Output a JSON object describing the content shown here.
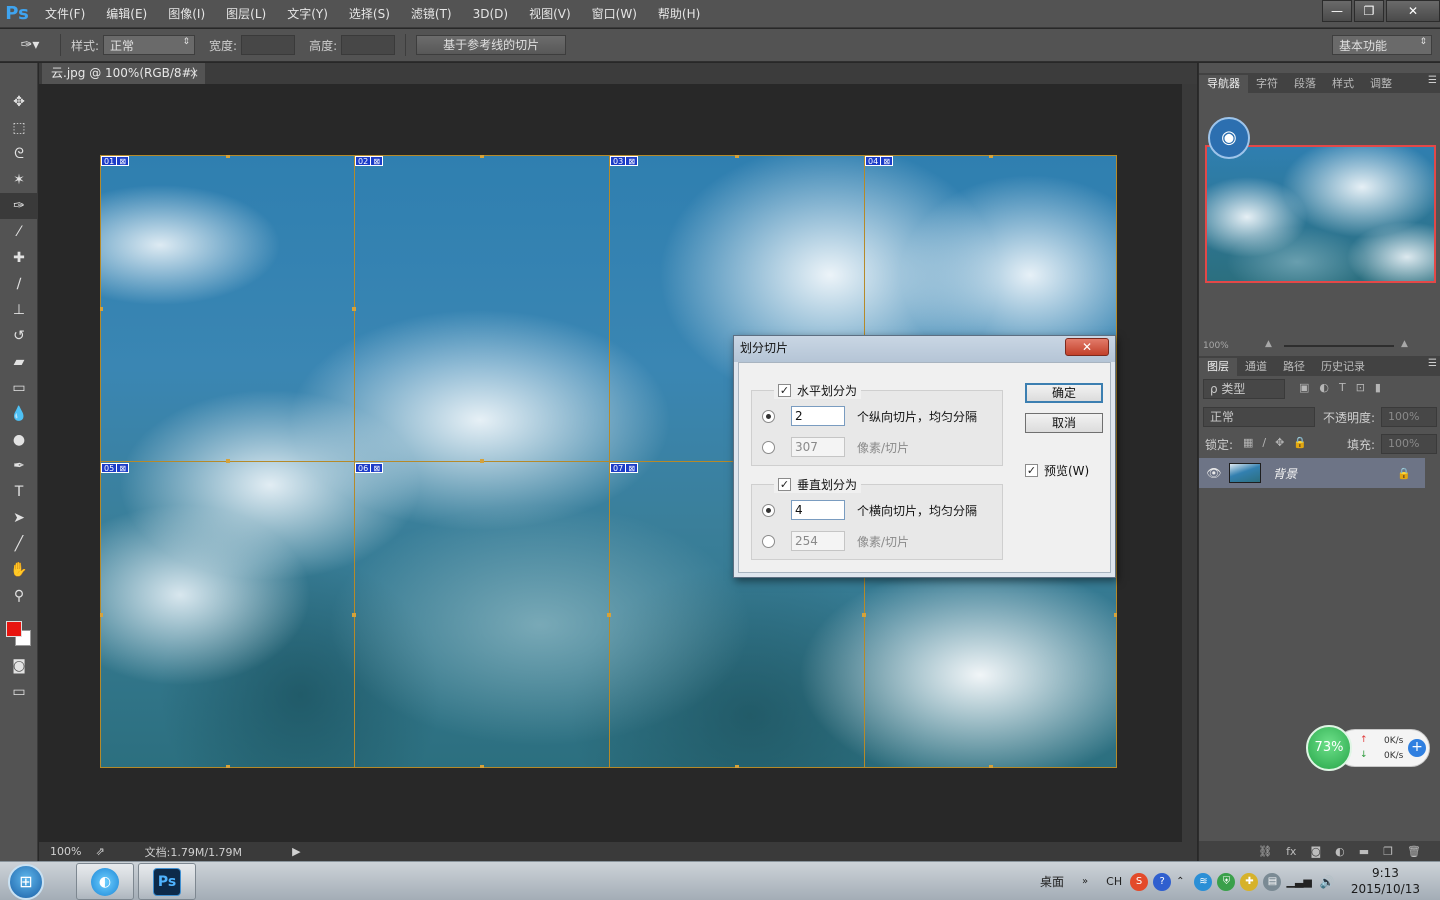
{
  "app": {
    "logo": "Ps"
  },
  "menu": [
    "文件(F)",
    "编辑(E)",
    "图像(I)",
    "图层(L)",
    "文字(Y)",
    "选择(S)",
    "滤镜(T)",
    "3D(D)",
    "视图(V)",
    "窗口(W)",
    "帮助(H)"
  ],
  "window_controls": {
    "minimize": "—",
    "restore": "❐",
    "close": "✕"
  },
  "options": {
    "style_label": "样式:",
    "style_value": "正常",
    "width_label": "宽度:",
    "height_label": "高度:",
    "slice_from_guides": "基于参考线的切片",
    "workspace": "基本功能"
  },
  "document": {
    "tab_title": "云.jpg @ 100%(RGB/8#)",
    "tab_close": "×"
  },
  "status": {
    "zoom": "100%",
    "doc_size": "文档:1.79M/1.79M"
  },
  "slices": [
    "01",
    "02",
    "03",
    "04",
    "05",
    "06",
    "07"
  ],
  "dialog": {
    "title": "划分切片",
    "close": "✕",
    "horizontal": {
      "label": "水平划分为",
      "checked": true,
      "count_value": "2",
      "count_suffix": "个纵向切片，均匀分隔",
      "pixels_value": "307",
      "pixels_suffix": "像素/切片"
    },
    "vertical": {
      "label": "垂直划分为",
      "checked": true,
      "count_value": "4",
      "count_suffix": "个横向切片，均匀分隔",
      "pixels_value": "254",
      "pixels_suffix": "像素/切片"
    },
    "ok": "确定",
    "cancel": "取消",
    "preview": "预览(W)"
  },
  "panels": {
    "top_tabs": [
      "导航器",
      "字符",
      "段落",
      "样式",
      "调整"
    ],
    "nav_zoom": "100%",
    "layer_tabs": [
      "图层",
      "通道",
      "路径",
      "历史记录"
    ],
    "kind_filter": "ρ 类型",
    "blend_mode": "正常",
    "opacity_label": "不透明度:",
    "opacity_value": "100%",
    "lock_label": "锁定:",
    "fill_label": "填充:",
    "fill_value": "100%",
    "layer_name": "背景"
  },
  "speed_widget": {
    "percent": "73%",
    "up": "0K/s",
    "down": "0K/s"
  },
  "taskbar": {
    "desktop": "桌面",
    "ime": "CH",
    "time": "9:13",
    "date": "2015/10/13"
  },
  "colors": {
    "foreground": "#e8150f",
    "background": "#ffffff",
    "accent": "#3fa4f0",
    "slice_line": "#b58a2a"
  }
}
